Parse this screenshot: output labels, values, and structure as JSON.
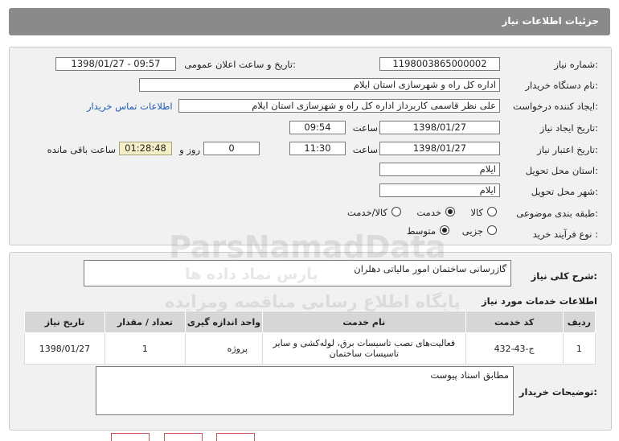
{
  "header": {
    "title": "جزئیات اطلاعات نیاز"
  },
  "form": {
    "need_number_label": "شماره نیاز:",
    "need_number": "1198003865000002",
    "announce_label": "تاریخ و ساعت اعلان عمومی:",
    "announce_value": "1398/01/27 - 09:57",
    "buyer_org_label": "نام دستگاه خریدار:",
    "buyer_org": "اداره کل راه و شهرسازی استان ایلام",
    "requester_label": "ایجاد کننده درخواست:",
    "requester": "علی نظر قاسمی کاربرداز اداره کل راه و شهرسازی استان ایلام",
    "contact_link": "اطلاعات تماس خریدار",
    "created_label": "تاریخ ایجاد نیاز:",
    "created_date": "1398/01/27",
    "time_label": "ساعت",
    "created_time": "09:54",
    "validity_label": "تاریخ اعتبار نیاز:",
    "validity_date": "1398/01/27",
    "validity_time": "11:30",
    "days_value": "0",
    "days_label": "روز و",
    "remaining_value": "01:28:48",
    "remaining_label": "ساعت باقی مانده",
    "province_label": "استان محل تحویل:",
    "province": "ایلام",
    "city_label": "شهر محل تحویل:",
    "city": "ایلام",
    "category_label": "طبقه بندی موضوعی:",
    "category_options": [
      "کالا",
      "خدمت",
      "کالا/خدمت"
    ],
    "category_selected": "خدمت",
    "process_label": "نوع فرآیند خرید :",
    "process_options": [
      "جزیی",
      "متوسط"
    ],
    "process_selected": "متوسط"
  },
  "summary": {
    "label": "شرح کلی نیاز:",
    "value": "گازرسانی ساختمان امور مالیاتی دهلران"
  },
  "services": {
    "title": "اطلاعات خدمات مورد نیاز",
    "columns": [
      "ردیف",
      "کد خدمت",
      "نام خدمت",
      "واحد اندازه گیری",
      "تعداد / مقدار",
      "تاریخ نیاز"
    ],
    "rows": [
      {
        "index": "1",
        "code": "ج-43-432",
        "name": "فعالیت‌های نصب تاسیسات برق، لوله‌کشی و سایر تاسیسات ساختمان",
        "unit": "پروژه",
        "qty": "1",
        "date": "1398/01/27"
      }
    ]
  },
  "buyer_notes": {
    "label": "توضیحات خریدار:",
    "value": "مطابق اسناد پیوست"
  },
  "watermark": {
    "line1": "ParsNamadData",
    "line2": "پایگاه اطلاع رسانی مناقصه ومزایده",
    "line3": "پارس نماد داده ها"
  }
}
